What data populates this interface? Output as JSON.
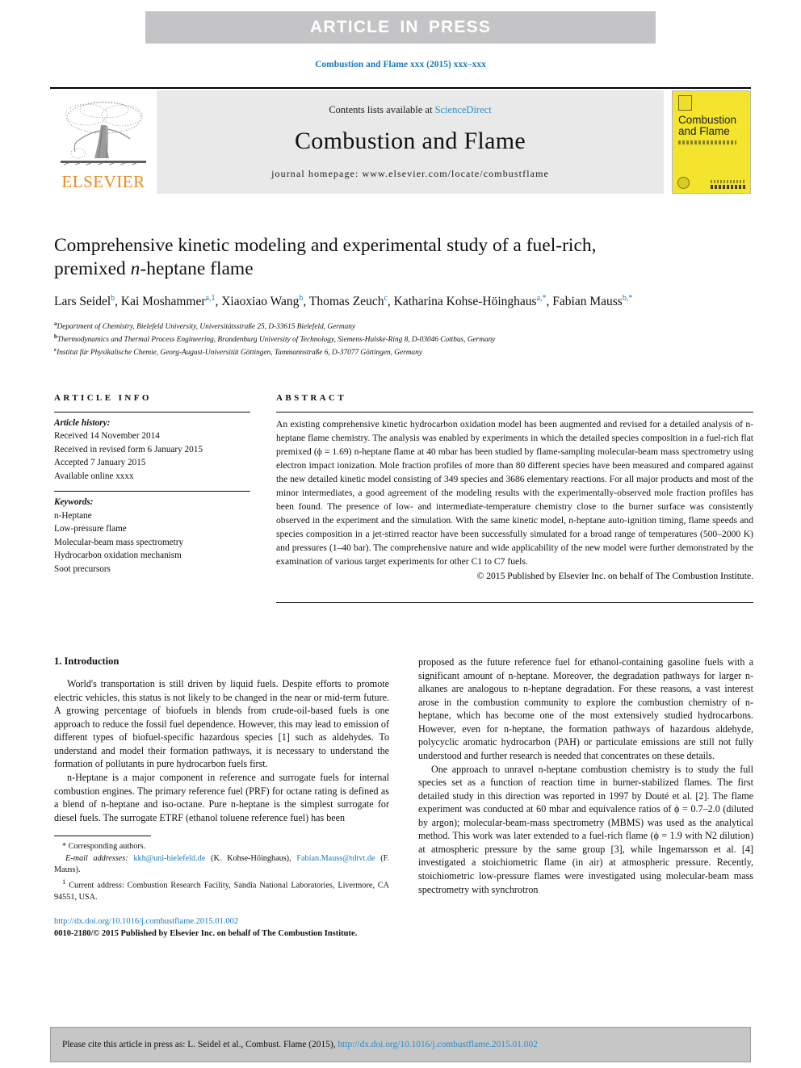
{
  "banner": {
    "text": "ARTICLE IN PRESS"
  },
  "running_head": "Combustion and Flame xxx (2015) xxx–xxx",
  "masthead": {
    "contents_prefix": "Contents lists available at ",
    "sciencedirect": "ScienceDirect",
    "journal_title": "Combustion and Flame",
    "homepage": "journal homepage: www.elsevier.com/locate/combustflame",
    "publisher_wordmark": "ELSEVIER",
    "cover_title_line1": "Combustion",
    "cover_title_line2": "and Flame",
    "accent_link_color": "#2b8fc9",
    "elsevier_orange": "#ea8b1f",
    "cover_yellow": "#f4e42e"
  },
  "article": {
    "title_line1": "Comprehensive kinetic modeling and experimental study of a fuel-rich,",
    "title_line2_pre": "premixed ",
    "title_line2_italic": "n",
    "title_line2_post": "-heptane flame",
    "authors_html_text": "Lars Seidel b, Kai Moshammer a,1, Xiaoxiao Wang b, Thomas Zeuch c, Katharina Kohse-Höinghaus a,*, Fabian Mauss b,*",
    "authors": [
      {
        "name": "Lars Seidel",
        "sup": "b",
        "sep": ", "
      },
      {
        "name": "Kai Moshammer",
        "sup": "a,1",
        "sep": ", "
      },
      {
        "name": "Xiaoxiao Wang",
        "sup": "b",
        "sep": ", "
      },
      {
        "name": "Thomas Zeuch",
        "sup": "c",
        "sep": ", "
      },
      {
        "name": "Katharina Kohse-Höinghaus",
        "sup": "a,*",
        "sep": ", "
      },
      {
        "name": "Fabian Mauss",
        "sup": "b,*",
        "sep": ""
      }
    ],
    "affiliations": [
      {
        "mark": "a",
        "text": "Department of Chemistry, Bielefeld University, Universitätsstraße 25, D-33615 Bielefeld, Germany"
      },
      {
        "mark": "b",
        "text": "Thermodynamics and Thermal Process Engineering, Brandenburg University of Technology, Siemens-Halske-Ring 8, D-03046 Cottbus, Germany"
      },
      {
        "mark": "c",
        "text": "Institut für Physikalische Chemie, Georg-August-Universität Göttingen, Tammannstraße 6, D-37077 Göttingen, Germany"
      }
    ]
  },
  "article_info": {
    "heading": "ARTICLE INFO",
    "history_label": "Article history:",
    "history": [
      "Received 14 November 2014",
      "Received in revised form 6 January 2015",
      "Accepted 7 January 2015",
      "Available online xxxx"
    ],
    "keywords_label": "Keywords:",
    "keywords": [
      "n-Heptane",
      "Low-pressure flame",
      "Molecular-beam mass spectrometry",
      "Hydrocarbon oxidation mechanism",
      "Soot precursors"
    ]
  },
  "abstract": {
    "heading": "ABSTRACT",
    "text": "An existing comprehensive kinetic hydrocarbon oxidation model has been augmented and revised for a detailed analysis of n-heptane flame chemistry. The analysis was enabled by experiments in which the detailed species composition in a fuel-rich flat premixed (ϕ = 1.69) n-heptane flame at 40 mbar has been studied by flame-sampling molecular-beam mass spectrometry using electron impact ionization. Mole fraction profiles of more than 80 different species have been measured and compared against the new detailed kinetic model consisting of 349 species and 3686 elementary reactions. For all major products and most of the minor intermediates, a good agreement of the modeling results with the experimentally-observed mole fraction profiles has been found. The presence of low- and intermediate-temperature chemistry close to the burner surface was consistently observed in the experiment and the simulation. With the same kinetic model, n-heptane auto-ignition timing, flame speeds and species composition in a jet-stirred reactor have been successfully simulated for a broad range of temperatures (500–2000 K) and pressures (1–40 bar). The comprehensive nature and wide applicability of the new model were further demonstrated by the examination of various target experiments for other C1 to C7 fuels.",
    "copyright": "© 2015 Published by Elsevier Inc. on behalf of The Combustion Institute."
  },
  "introduction": {
    "heading": "1. Introduction",
    "left_paragraphs": [
      "World's transportation is still driven by liquid fuels. Despite efforts to promote electric vehicles, this status is not likely to be changed in the near or mid-term future. A growing percentage of biofuels in blends from crude-oil-based fuels is one approach to reduce the fossil fuel dependence. However, this may lead to emission of different types of biofuel-specific hazardous species [1] such as aldehydes. To understand and model their formation pathways, it is necessary to understand the formation of pollutants in pure hydrocarbon fuels first.",
      "n-Heptane is a major component in reference and surrogate fuels for internal combustion engines. The primary reference fuel (PRF) for octane rating is defined as a blend of n-heptane and iso-octane. Pure n-heptane is the simplest surrogate for diesel fuels. The surrogate ETRF (ethanol toluene reference fuel) has been"
    ],
    "right_paragraphs": [
      "proposed as the future reference fuel for ethanol-containing gasoline fuels with a significant amount of n-heptane. Moreover, the degradation pathways for larger n-alkanes are analogous to n-heptane degradation. For these reasons, a vast interest arose in the combustion community to explore the combustion chemistry of n-heptane, which has become one of the most extensively studied hydrocarbons. However, even for n-heptane, the formation pathways of hazardous aldehyde, polycyclic aromatic hydrocarbon (PAH) or particulate emissions are still not fully understood and further research is needed that concentrates on these details.",
      "One approach to unravel n-heptane combustion chemistry is to study the full species set as a function of reaction time in burner-stabilized flames. The first detailed study in this direction was reported in 1997 by Douté et al. [2]. The flame experiment was conducted at 60 mbar and equivalence ratios of ϕ = 0.7–2.0 (diluted by argon); molecular-beam-mass spectrometry (MBMS) was used as the analytical method. This work was later extended to a fuel-rich flame (ϕ = 1.9 with N2 dilution) at atmospheric pressure by the same group [3], while Ingemarsson et al. [4] investigated a stoichiometric flame (in air) at atmospheric pressure. Recently, stoichiometric low-pressure flames were investigated using molecular-beam mass spectrometry with synchrotron"
    ]
  },
  "footnotes": {
    "corresponding_mark": "*",
    "corresponding_text": "Corresponding authors.",
    "email_label": "E-mail addresses:",
    "email_1": "kkh@uni-bielefeld.de",
    "email_1_who": "(K. Kohse-Höinghaus),",
    "email_2": "Fabian.Mauss@tdtvt.de",
    "email_2_who": "(F. Mauss).",
    "note_mark": "1",
    "note_text": "Current address: Combustion Research Facility, Sandia National Laboratories, Livermore, CA 94551, USA."
  },
  "doi_block": {
    "doi_url": "http://dx.doi.org/10.1016/j.combustflame.2015.01.002",
    "issn_line": "0010-2180/© 2015 Published by Elsevier Inc. on behalf of The Combustion Institute."
  },
  "cite_footer": {
    "prefix": "Please cite this article in press as: L. Seidel et al., Combust. Flame (2015), ",
    "link": "http://dx.doi.org/10.1016/j.combustflame.2015.01.002"
  }
}
